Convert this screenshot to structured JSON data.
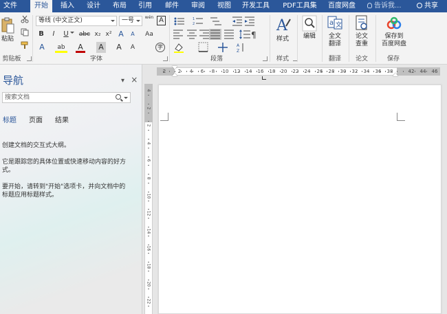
{
  "tabs": [
    "文件",
    "开始",
    "插入",
    "设计",
    "布局",
    "引用",
    "邮件",
    "审阅",
    "视图",
    "开发工具",
    "PDF工具集",
    "百度网盘"
  ],
  "active_tab": "开始",
  "tell_me": "告诉我...",
  "share": "共享",
  "ribbon": {
    "clipboard": {
      "paste": "粘贴",
      "label": "剪贴板"
    },
    "font": {
      "name": "等线 (中文正文)",
      "size": "一号",
      "wen": "wén",
      "A_box": "A",
      "bold": "B",
      "italic": "I",
      "underline": "U",
      "strike": "abc",
      "subscript": "x₂",
      "superscript": "x²",
      "grow": "A",
      "shrink": "A",
      "aa": "Aa",
      "highlight": "ab",
      "fontcolor": "A",
      "fontA2": "A",
      "label": "字体"
    },
    "paragraph": {
      "label": "段落"
    },
    "styles": {
      "button": "样式",
      "label": "样式"
    },
    "editing": {
      "button": "编辑"
    },
    "translate": {
      "button_l1": "全文",
      "button_l2": "翻译",
      "label": "翻译"
    },
    "paper": {
      "button_l1": "论文",
      "button_l2": "查重",
      "label": "论文"
    },
    "save": {
      "button_l1": "保存到",
      "button_l2": "百度网盘",
      "label": "保存"
    }
  },
  "nav": {
    "title": "导航",
    "pin": "▾",
    "close": "×",
    "search_placeholder": "搜索文档",
    "tabs": [
      "标题",
      "页面",
      "结果"
    ],
    "lines": [
      "创建文档的交互式大纲。",
      "它是跟踪您的具体位置或快速移动内容的好方",
      "式。",
      "要开始，请转到\"开始\"选项卡，并向文档中的",
      "标题应用标题样式。"
    ]
  },
  "hruler_numbers": [
    "2",
    "2",
    "4",
    "6",
    "8",
    "10",
    "12",
    "14",
    "16",
    "18",
    "20",
    "22",
    "24",
    "26",
    "28",
    "30",
    "32",
    "34",
    "36",
    "38",
    "42",
    "44",
    "46"
  ],
  "vruler_numbers": [
    "4",
    "2",
    "2",
    "4",
    "6",
    "8",
    "10",
    "12",
    "14",
    "16",
    "18",
    "20",
    "22"
  ],
  "colors": {
    "accent": "#2b579a",
    "highlight": "#ffff00",
    "font_red": "#c00000"
  }
}
